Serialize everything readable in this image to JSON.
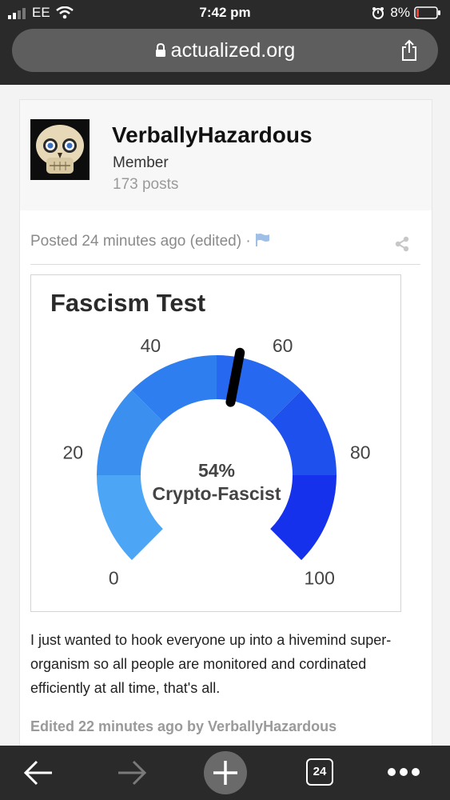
{
  "status_bar": {
    "carrier": "EE",
    "time": "7:42 pm",
    "battery": "8%"
  },
  "browser": {
    "url": "actualized.org",
    "tab_count": "24"
  },
  "post": {
    "author": {
      "name": "VerballyHazardous",
      "role": "Member",
      "posts": "173 posts"
    },
    "meta": "Posted 24 minutes ago (edited) ·",
    "quiz": {
      "title": "Fascism Test",
      "result_value": "54%",
      "result_label": "Crypto-Fascist",
      "needle_percent": 54
    },
    "body": "I just wanted to hook everyone up into a hivemind super-organism so all people are monitored and cordinated efficiently at all time, that's all.",
    "edited": "Edited 22 minutes ago by VerballyHazardous"
  },
  "chart_data": {
    "type": "gauge",
    "title": "Fascism Test",
    "ticks": [
      "0",
      "20",
      "40",
      "60",
      "80",
      "100"
    ],
    "value": 54,
    "value_label": "54%",
    "category": "Crypto-Fascist",
    "segment_colors": [
      "#4da6f5",
      "#3b90ef",
      "#2f7ef0",
      "#2668f0",
      "#1e50ee",
      "#1531eb"
    ]
  }
}
